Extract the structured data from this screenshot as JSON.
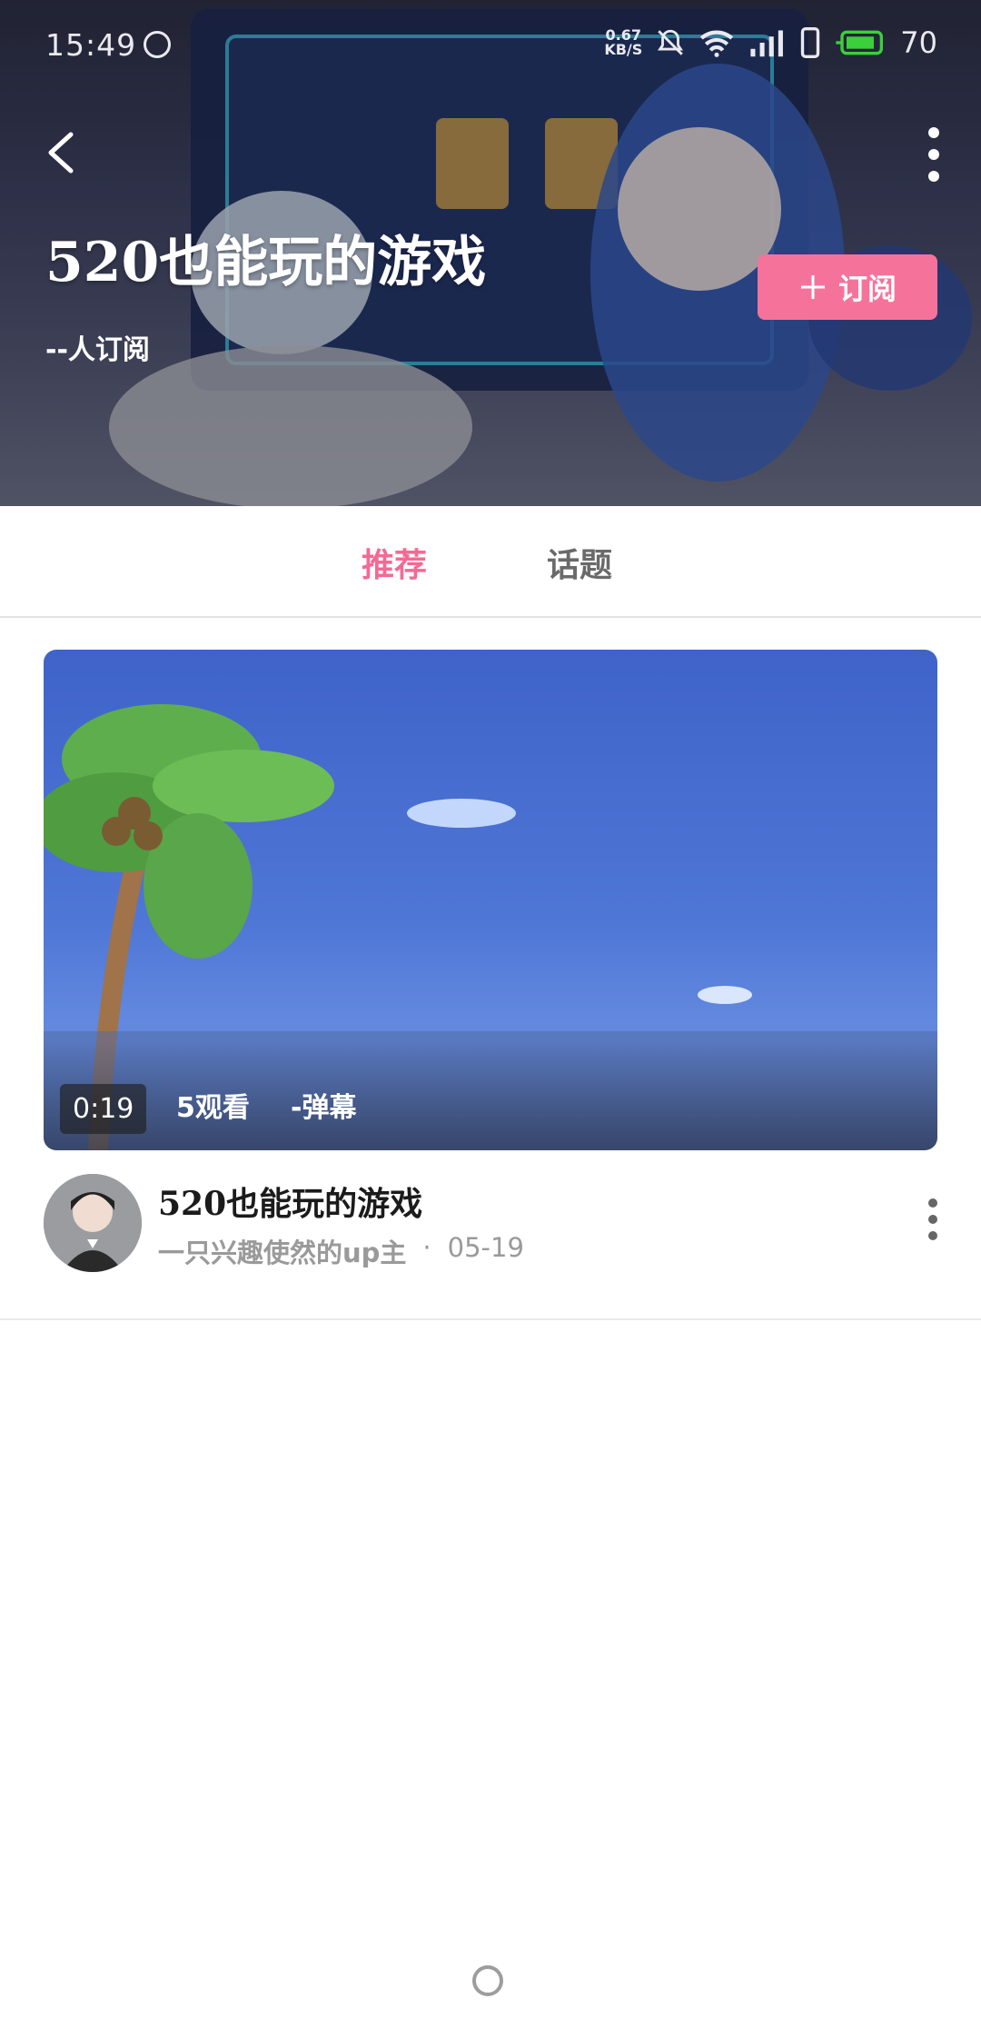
{
  "status_bar": {
    "time": "15:49",
    "net_speed": "0.67\nKB/S",
    "battery_level": "70",
    "icons": [
      "netease-icon",
      "bell-muted-icon",
      "wifi-icon",
      "signal-4g-icon",
      "sim-icon",
      "battery-charging-icon"
    ]
  },
  "header": {
    "back_icon": "back-arrow-icon",
    "more_icon": "more-vertical-icon",
    "title": "520也能玩的游戏",
    "subscriber_count": "--人订阅",
    "subscribe_label": "订阅",
    "subscribe_icon": "plus-icon",
    "accent_color": "#f5739a"
  },
  "tabs": [
    {
      "label": "推荐",
      "active": true
    },
    {
      "label": "话题",
      "active": false
    }
  ],
  "video": {
    "duration": "0:19",
    "views": "5观看",
    "danmaku": "-弹幕",
    "title": "520也能玩的游戏",
    "uploader": "一只兴趣使然的up主",
    "separator": "·",
    "date": "05-19"
  }
}
